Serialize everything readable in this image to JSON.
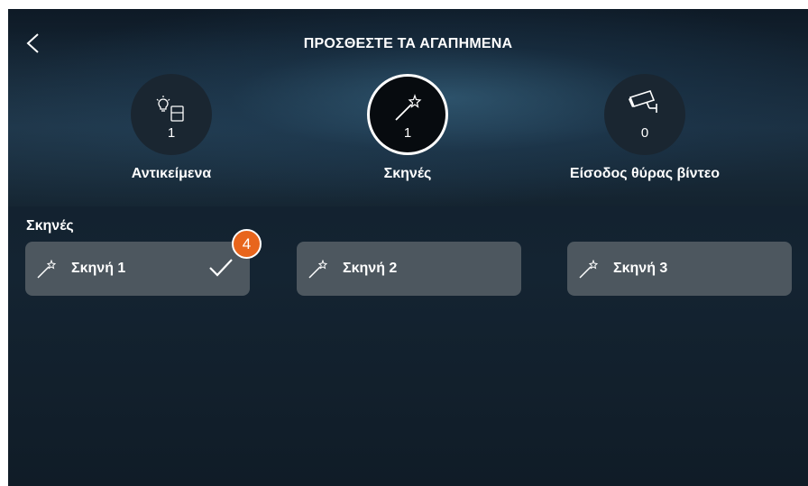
{
  "header": {
    "title": "ΠΡΟΣΘΕΣΤΕ ΤΑ ΑΓΑΠΗΜΕΝΑ",
    "back_icon": "chevron-left-icon"
  },
  "categories": [
    {
      "label": "Αντικείμενα",
      "count": "1",
      "icon": "lightbulb-switch-icon",
      "selected": false
    },
    {
      "label": "Σκηνές",
      "count": "1",
      "icon": "magic-wand-icon",
      "selected": true
    },
    {
      "label": "Είσοδος θύρας βίντεο",
      "count": "0",
      "icon": "security-camera-icon",
      "selected": false
    }
  ],
  "section": {
    "label": "Σκηνές"
  },
  "scenes": [
    {
      "name": "Σκηνή 1",
      "selected": true
    },
    {
      "name": "Σκηνή 2",
      "selected": false
    },
    {
      "name": "Σκηνή 3",
      "selected": false
    }
  ],
  "badge": {
    "value": "4"
  },
  "colors": {
    "accent_badge": "#e8651c",
    "tile": "#4d575f",
    "background": "#13212d"
  }
}
